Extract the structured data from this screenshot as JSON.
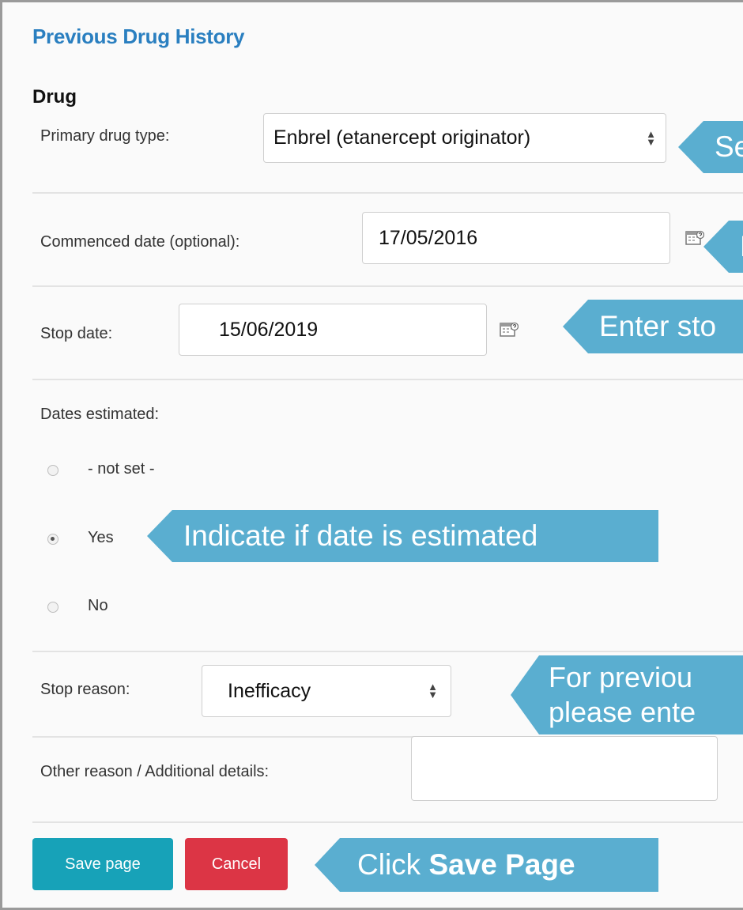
{
  "page_title": "Previous Drug History",
  "section_title": "Drug",
  "fields": {
    "primary_drug_type": {
      "label": "Primary drug type:",
      "value": "Enbrel (etanercept originator)"
    },
    "commenced_date": {
      "label": "Commenced date (optional):",
      "value": "17/05/2016"
    },
    "stop_date": {
      "label": "Stop date:",
      "value": "15/06/2019"
    },
    "dates_estimated": {
      "label": "Dates estimated:",
      "options": [
        "- not set -",
        "Yes",
        "No"
      ],
      "selected": "Yes"
    },
    "stop_reason": {
      "label": "Stop reason:",
      "value": "Inefficacy"
    },
    "other_reason": {
      "label": "Other reason / Additional details:",
      "value": ""
    }
  },
  "buttons": {
    "save": "Save page",
    "cancel": "Cancel"
  },
  "callouts": {
    "primary_drug_type": "Se",
    "commenced_date": "E",
    "stop_date": "Enter sto",
    "dates_estimated": "Indicate if date is estimated",
    "stop_reason_line1": "For previou",
    "stop_reason_line2": "please ente",
    "save_prefix": "Click ",
    "save_bold": "Save Page"
  },
  "colors": {
    "title_blue": "#2a7fc0",
    "callout_blue": "#5aaed0",
    "save_button": "#17a2b8",
    "cancel_button": "#dc3545"
  },
  "icons": {
    "calendar": "calendar-icon",
    "select_caret": "select-caret-icon"
  }
}
